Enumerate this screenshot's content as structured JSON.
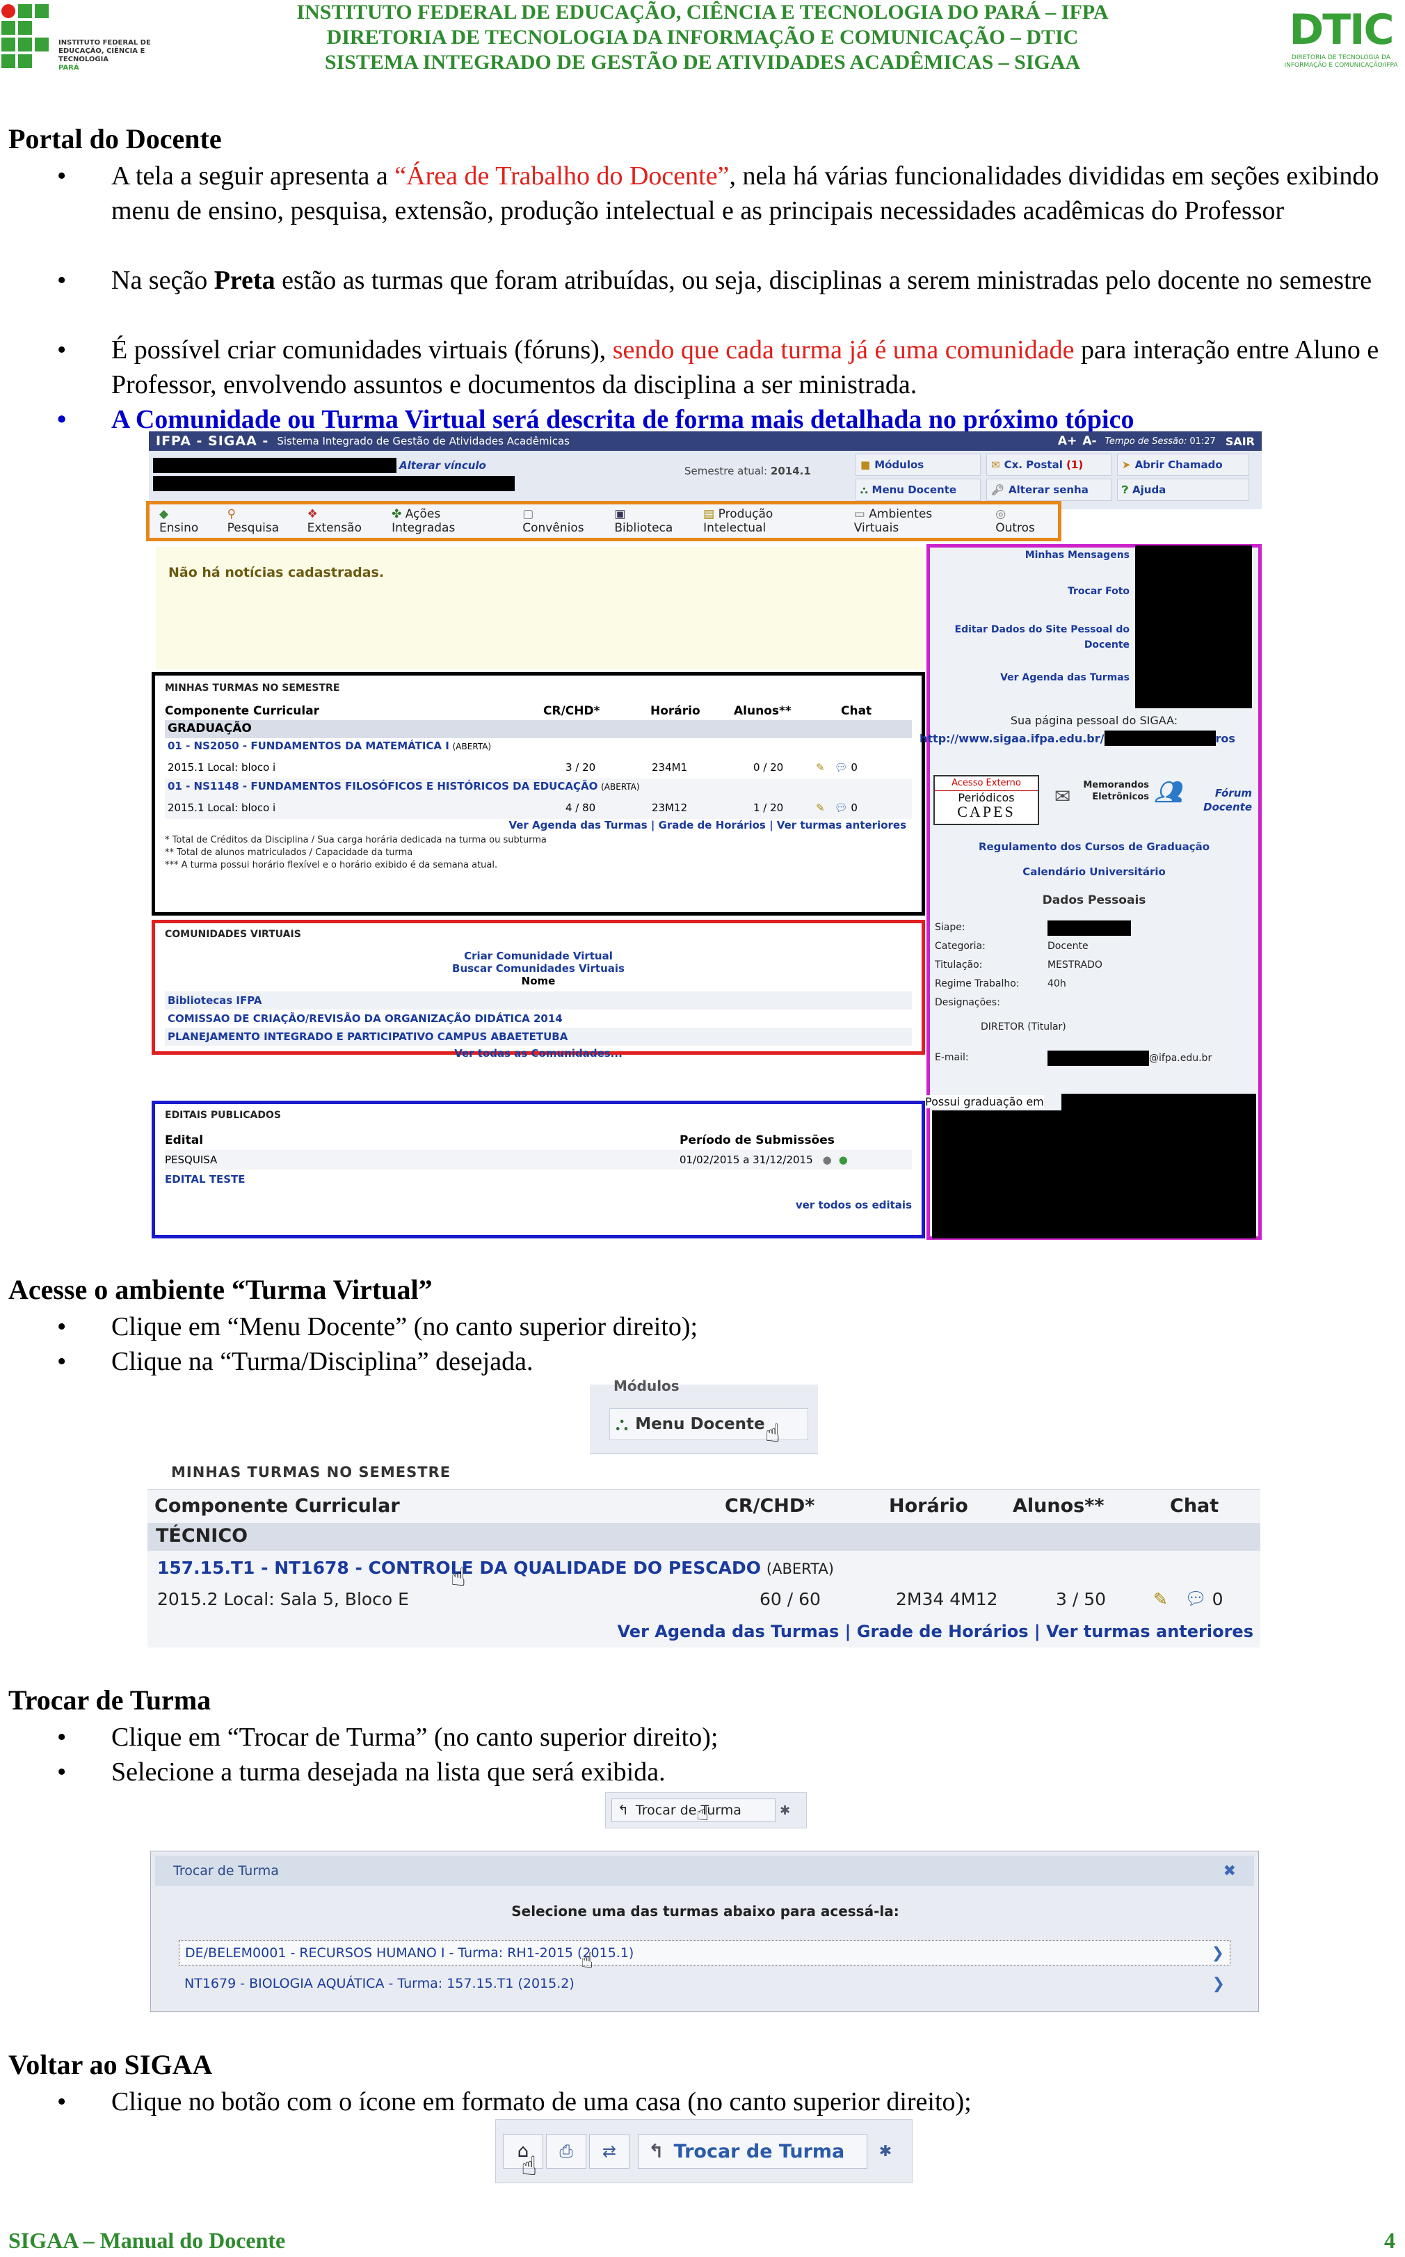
{
  "header": {
    "line1": "INSTITUTO FEDERAL DE EDUCAÇÃO, CIÊNCIA E TECNOLOGIA DO PARÁ – IFPA",
    "line2": "DIRETORIA DE TECNOLOGIA DA INFORMAÇÃO E COMUNICAÇÃO – DTIC",
    "line3": "SISTEMA INTEGRADO DE GESTÃO DE ATIVIDADES ACADÊMICAS – SIGAA",
    "logo_left_lines": [
      "INSTITUTO FEDERAL DE",
      "EDUCAÇÃO, CIÊNCIA E TECNOLOGIA",
      "PARÁ"
    ],
    "logo_right_text": "DTIC",
    "logo_right_sub": "DIRETORIA DE TECNOLOGIA DA INFORMAÇÃO E COMUNICAÇÃO/IFPA"
  },
  "s1": {
    "title": "Portal do Docente",
    "b1a": "A tela a seguir apresenta a ",
    "b1b": "“Área de Trabalho do Docente”",
    "b1c": ", nela há várias funcionalidades divididas em seções exibindo menu de ensino, pesquisa, extensão, produção intelectual e as principais necessidades acadêmicas do Professor",
    "b2a": "Na seção ",
    "b2b": "Preta",
    "b2c": " estão as turmas que foram atribuídas, ou seja, disciplinas a serem ministradas pelo docente no semestre",
    "b3a": "É possível criar comunidades virtuais (fóruns), ",
    "b3b": "sendo que cada turma já é uma comunidade",
    "b3c": " para interação entre Aluno e Professor, envolvendo assuntos e documentos da disciplina a ser ministrada.",
    "b4": "A Comunidade ou Turma Virtual será descrita de forma mais detalhada no próximo tópico"
  },
  "sigaa": {
    "topbar_title": "IFPA - SIGAA -",
    "topbar_sub": "Sistema Integrado de Gestão de Atividades Acadêmicas",
    "font_a_plus": "A+",
    "font_a_minus": "A-",
    "session_label": "Tempo de Sessão:",
    "session_time": "01:27",
    "sair": "SAIR",
    "alterar_vinculo": "Alterar vínculo",
    "semestre_label": "Semestre atual:",
    "semestre": "2014.1",
    "quick": [
      "Módulos",
      "Cx. Postal",
      "Abrir Chamado",
      "Menu Docente",
      "Alterar senha",
      "Ajuda"
    ],
    "cx_postal_count": "(1)",
    "menu": [
      "Ensino",
      "Pesquisa",
      "Extensão",
      "Ações Integradas",
      "Convênios",
      "Biblioteca",
      "Produção Intelectual",
      "Ambientes Virtuais",
      "Outros"
    ],
    "no_news": "Não há notícias cadastradas.",
    "turmas_title": "Minhas turmas no semestre",
    "turmas_cols": [
      "Componente Curricular",
      "CR/CHD*",
      "Horário",
      "Alunos**",
      "Chat"
    ],
    "turmas_group": "GRADUAÇÃO",
    "turmas": [
      {
        "name": "01 - NS2050 - FUNDAMENTOS DA MATEMÁTICA I",
        "status": "(ABERTA)",
        "local": "2015.1 Local: bloco i",
        "cr": "3 / 20",
        "hor": "234M1",
        "alunos": "0 / 20",
        "chat": "0"
      },
      {
        "name": "01 - NS1148 - FUNDAMENTOS FILOSÓFICOS E HISTÓRICOS DA EDUCAÇÃO",
        "status": "(ABERTA)",
        "local": "2015.1 Local: bloco i",
        "cr": "4 / 80",
        "hor": "23M12",
        "alunos": "1 / 20",
        "chat": "0"
      }
    ],
    "turmas_links": [
      "Ver Agenda das Turmas",
      "Grade de Horários",
      "Ver turmas anteriores"
    ],
    "turmas_notes": [
      "* Total de Créditos da Disciplina / Sua carga horária dedicada na turma ou subturma",
      "** Total de alunos matriculados / Capacidade da turma",
      "*** A turma possui horário flexível e o horário exibido é da semana atual."
    ],
    "com_title": "Comunidades Virtuais",
    "com_create": "Criar Comunidade Virtual",
    "com_search": "Buscar Comunidades Virtuais",
    "com_nome": "Nome",
    "com_items": [
      "Bibliotecas IFPA",
      "COMISSAO DE CRIAÇÃO/REVISÃO DA ORGANIZAÇÃO DIDÁTICA 2014",
      "PLANEJAMENTO INTEGRADO E PARTICIPATIVO CAMPUS ABAETETUBA"
    ],
    "com_all": "Ver todas as Comunidades...",
    "ed_title": "Editais Publicados",
    "ed_col1": "Edital",
    "ed_col2": "Período de Submissões",
    "ed_items": [
      {
        "name": "PESQUISA",
        "period": "01/02/2015 a 31/12/2015"
      },
      {
        "name": "EDITAL TESTE",
        "period": ""
      }
    ],
    "ed_all": "ver todos os editais",
    "side_links": [
      "Minhas Mensagens",
      "Trocar Foto",
      "Editar Dados do Site Pessoal do Docente",
      "Ver Agenda das Turmas"
    ],
    "personal_page_label": "Sua página pessoal do SIGAA:",
    "personal_page_url": "http://www.sigaa.ifpa.edu.br/",
    "personal_page_tail": "ros",
    "acesso_top": "Acesso Externo",
    "acesso_mid": "Periódicos",
    "capes": "CAPES",
    "memorandos": "Memorandos Eletrônicos",
    "forum": "Fórum Docente",
    "reg_link": "Regulamento dos Cursos de Graduação",
    "cal_link": "Calendário Universitário",
    "dp_title": "Dados Pessoais",
    "dp_labels": [
      "Siape:",
      "Categoria:",
      "Titulação:",
      "Regime Trabalho:",
      "Designações:"
    ],
    "dp_values": [
      "",
      "Docente",
      "MESTRADO",
      "40h",
      ""
    ],
    "dp_role": "DIRETOR (Titular)",
    "dp_email_label": "E-mail:",
    "dp_email": "@ifpa.edu.br",
    "dp_grad": "Possui graduação em"
  },
  "s2": {
    "title": "Acesse o ambiente “Turma Virtual”",
    "b1": "Clique em “Menu Docente” (no canto superior direito);",
    "b2": "Clique na “Turma/Disciplina” desejada."
  },
  "md": {
    "top": "Módulos",
    "label": "Menu Docente"
  },
  "mt": {
    "title": "Minhas turmas no semestre",
    "cols": [
      "Componente Curricular",
      "CR/CHD*",
      "Horário",
      "Alunos**",
      "Chat"
    ],
    "group": "TÉCNICO",
    "name": "157.15.T1 - NT1678 - CONTROLE DA QUALIDADE DO PESCADO",
    "status": "(ABERTA)",
    "local": "2015.2 Local: Sala 5, Bloco E",
    "cr": "60 / 60",
    "hor": "2M34 4M12",
    "alunos": "3 / 50",
    "chat": "0",
    "links": [
      "Ver Agenda das Turmas",
      "Grade de Horários",
      "Ver turmas anteriores"
    ]
  },
  "s3": {
    "title": "Trocar de Turma",
    "b1": "Clique em “Trocar de Turma” (no canto superior direito);",
    "b2": "Selecione a turma desejada na lista que será exibida."
  },
  "trocar": {
    "btn": "Trocar de Turma",
    "dlg_title": "Trocar de Turma",
    "instr": "Selecione uma das turmas abaixo para acessá-la:",
    "items": [
      "DE/BELEM0001 - RECURSOS HUMANO I - Turma: RH1-2015 (2015.1)",
      "NT1679 - BIOLOGIA AQUÁTICA - Turma: 157.15.T1 (2015.2)"
    ]
  },
  "s4": {
    "title": "Voltar ao SIGAA",
    "b1": "Clique no botão com o ícone em formato de uma casa (no canto superior direito);"
  },
  "toolbar": {
    "btn": "Trocar de Turma"
  },
  "footer": {
    "left": "SIGAA – Manual do Docente",
    "page": "4"
  },
  "colors": {
    "header_green": "#2e8b2e",
    "highlight_red": "#e0211b",
    "highlight_blue": "#0000cc",
    "sigaa_bar": "#33427a",
    "box_orange": "#e8861a",
    "box_black": "#000000",
    "box_red": "#e02020",
    "box_blue": "#1a1acc",
    "box_magenta": "#cc22cc"
  }
}
